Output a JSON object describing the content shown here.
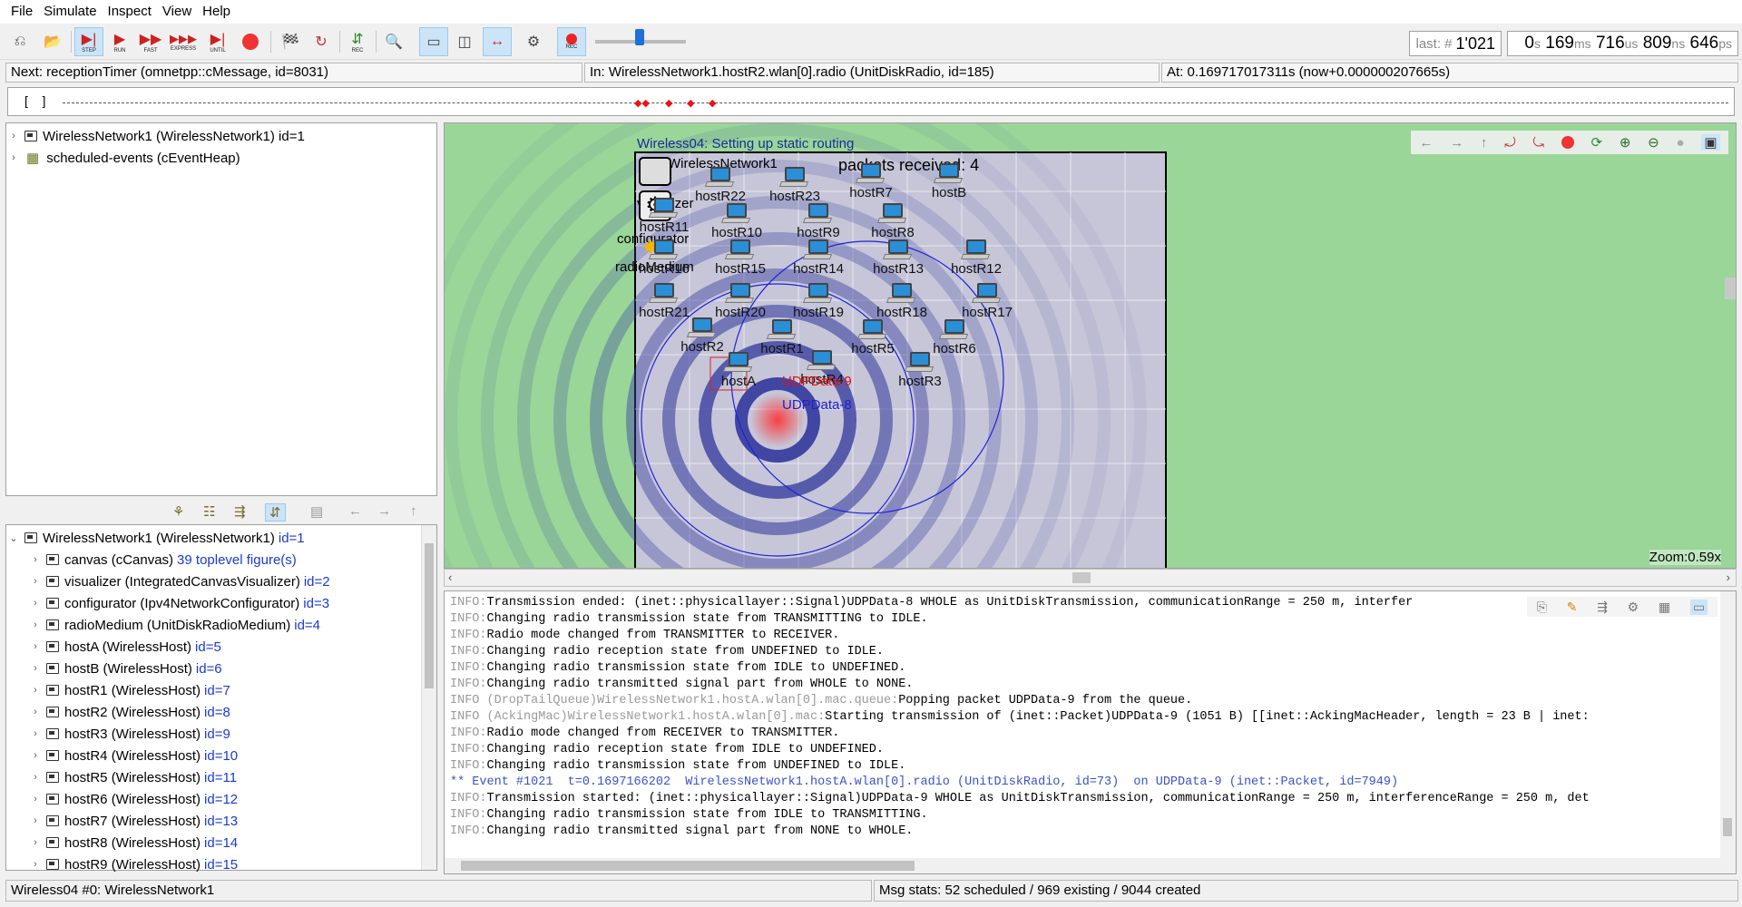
{
  "menu": [
    "File",
    "Simulate",
    "Inspect",
    "View",
    "Help"
  ],
  "toolbar": {
    "step": "STEP",
    "run": "RUN",
    "fast": "FAST",
    "express": "EXPRESS",
    "until": "UNTIL",
    "rec": "REC"
  },
  "status_event": {
    "label": "last: #",
    "value": "1'021"
  },
  "sim_time": {
    "s": "0",
    "s_u": "s",
    "ms": "169",
    "ms_u": "ms",
    "us": "716",
    "us_u": "us",
    "ns": "809",
    "ns_u": "ns",
    "ps": "646",
    "ps_u": "ps"
  },
  "info": {
    "next": "Next: receptionTimer (omnetpp::cMessage, id=8031)",
    "in": "In: WirelessNetwork1.hostR2.wlan[0].radio (UnitDiskRadio, id=185)",
    "at": "At: 0.169717017311s (now+0.000000207665s)"
  },
  "timeline": {
    "bracket": "[    ]"
  },
  "tree_top": [
    {
      "label": "WirelessNetwork1 (WirelessNetwork1) id=1",
      "icon": "module-icon"
    },
    {
      "label": "scheduled-events (cEventHeap)",
      "icon": "queue-icon"
    }
  ],
  "tree_bottom": [
    {
      "label": "WirelessNetwork1 (WirelessNetwork1)",
      "id": "id=1",
      "expanded": true,
      "indent": 0
    },
    {
      "label": "canvas (cCanvas)",
      "id": "39 toplevel figure(s)",
      "indent": 1
    },
    {
      "label": "visualizer (IntegratedCanvasVisualizer)",
      "id": "id=2",
      "indent": 1
    },
    {
      "label": "configurator (Ipv4NetworkConfigurator)",
      "id": "id=3",
      "indent": 1
    },
    {
      "label": "radioMedium (UnitDiskRadioMedium)",
      "id": "id=4",
      "indent": 1
    },
    {
      "label": "hostA (WirelessHost)",
      "id": "id=5",
      "indent": 1
    },
    {
      "label": "hostB (WirelessHost)",
      "id": "id=6",
      "indent": 1
    },
    {
      "label": "hostR1 (WirelessHost)",
      "id": "id=7",
      "indent": 1
    },
    {
      "label": "hostR2 (WirelessHost)",
      "id": "id=8",
      "indent": 1
    },
    {
      "label": "hostR3 (WirelessHost)",
      "id": "id=9",
      "indent": 1
    },
    {
      "label": "hostR4 (WirelessHost)",
      "id": "id=10",
      "indent": 1
    },
    {
      "label": "hostR5 (WirelessHost)",
      "id": "id=11",
      "indent": 1
    },
    {
      "label": "hostR6 (WirelessHost)",
      "id": "id=12",
      "indent": 1
    },
    {
      "label": "hostR7 (WirelessHost)",
      "id": "id=13",
      "indent": 1
    },
    {
      "label": "hostR8 (WirelessHost)",
      "id": "id=14",
      "indent": 1
    },
    {
      "label": "hostR9 (WirelessHost)",
      "id": "id=15",
      "indent": 1
    }
  ],
  "canvas": {
    "title": "Wireless04: Setting up static routing",
    "network": "WirelessNetwork1",
    "packets": "packets received: 4",
    "zoom": "Zoom:0.59x",
    "module_labels": {
      "visualizer": "visualizer",
      "configurator": "configurator",
      "radioMedium": "radioMedium"
    },
    "packet_labels": {
      "p9": "UDPData-9",
      "p8": "UDPData-8"
    },
    "hosts": [
      {
        "name": "hostR22"
      },
      {
        "name": "hostR23"
      },
      {
        "name": "hostR7"
      },
      {
        "name": "hostB"
      },
      {
        "name": "hostR11"
      },
      {
        "name": "hostR10"
      },
      {
        "name": "hostR9"
      },
      {
        "name": "hostR8"
      },
      {
        "name": "hostR16"
      },
      {
        "name": "hostR15"
      },
      {
        "name": "hostR14"
      },
      {
        "name": "hostR13"
      },
      {
        "name": "hostR12"
      },
      {
        "name": "hostR21"
      },
      {
        "name": "hostR20"
      },
      {
        "name": "hostR19"
      },
      {
        "name": "hostR18"
      },
      {
        "name": "hostR17"
      },
      {
        "name": "hostR2"
      },
      {
        "name": "hostR1"
      },
      {
        "name": "hostR5"
      },
      {
        "name": "hostR6"
      },
      {
        "name": "hostA"
      },
      {
        "name": "hostR4"
      },
      {
        "name": "hostR3"
      }
    ]
  },
  "log": [
    {
      "p": "INFO:",
      "t": "Transmission ended: (inet::physicallayer::Signal)UDPData-8 WHOLE as UnitDiskTransmission, communicationRange = 250 m, interfer"
    },
    {
      "p": "INFO:",
      "t": "Changing radio transmission state from TRANSMITTING to IDLE."
    },
    {
      "p": "INFO:",
      "t": "Radio mode changed from TRANSMITTER to RECEIVER."
    },
    {
      "p": "INFO:",
      "t": "Changing radio reception state from UNDEFINED to IDLE."
    },
    {
      "p": "INFO:",
      "t": "Changing radio transmission state from IDLE to UNDEFINED."
    },
    {
      "p": "INFO:",
      "t": "Changing radio transmitted signal part from WHOLE to NONE."
    },
    {
      "p": "INFO (DropTailQueue)WirelessNetwork1.hostA.wlan[0].mac.queue:",
      "t": "Popping packet UDPData-9 from the queue."
    },
    {
      "p": "INFO (AckingMac)WirelessNetwork1.hostA.wlan[0].mac:",
      "t": "Starting transmission of (inet::Packet)UDPData-9 (1051 B) [[inet::AckingMacHeader, length = 23 B | inet:"
    },
    {
      "p": "INFO:",
      "t": "Radio mode changed from RECEIVER to TRANSMITTER."
    },
    {
      "p": "INFO:",
      "t": "Changing radio reception state from IDLE to UNDEFINED."
    },
    {
      "p": "INFO:",
      "t": "Changing radio transmission state from UNDEFINED to IDLE."
    },
    {
      "p": "",
      "t": "** Event #1021  t=0.1697166202  WirelessNetwork1.hostA.wlan[0].radio (UnitDiskRadio, id=73)  on UDPData-9 (inet::Packet, id=7949)",
      "ev": true
    },
    {
      "p": "INFO:",
      "t": "Transmission started: (inet::physicallayer::Signal)UDPData-9 WHOLE as UnitDiskTransmission, communicationRange = 250 m, interferenceRange = 250 m, det"
    },
    {
      "p": "INFO:",
      "t": "Changing radio transmission state from IDLE to TRANSMITTING."
    },
    {
      "p": "INFO:",
      "t": "Changing radio transmitted signal part from NONE to WHOLE."
    }
  ],
  "status": {
    "left": "Wireless04 #0: WirelessNetwork1",
    "right": "Msg stats: 52 scheduled / 969 existing / 9044 created"
  }
}
